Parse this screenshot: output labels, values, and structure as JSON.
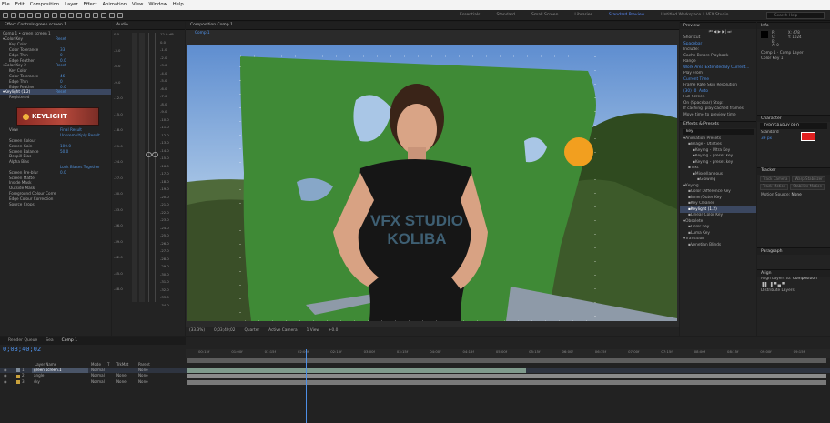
{
  "menubar": [
    "File",
    "Edit",
    "Composition",
    "Layer",
    "Effect",
    "Animation",
    "View",
    "Window",
    "Help"
  ],
  "workspaces": {
    "items": [
      "Essentials",
      "Standard",
      "Small Screen",
      "Libraries",
      "Standard Preview",
      "Untitled Workspace 1 VFX Studio"
    ],
    "active_index": 4
  },
  "search_help": {
    "placeholder": "Search Help"
  },
  "effect_controls": {
    "tab_label": "Effect Controls green screen.1",
    "breadcrumb": "Comp 1 • green screen 1",
    "rows": [
      {
        "label": "Color Key",
        "value": "Reset",
        "indent": 0,
        "sel": false
      },
      {
        "label": "Key Color",
        "value": "",
        "indent": 1,
        "sel": false
      },
      {
        "label": "Color Tolerance",
        "value": "33",
        "indent": 1,
        "sel": false
      },
      {
        "label": "Edge Thin",
        "value": "0",
        "indent": 1,
        "sel": false
      },
      {
        "label": "Edge Feather",
        "value": "0.0",
        "indent": 1,
        "sel": false
      },
      {
        "label": "Color Key 2",
        "value": "Reset",
        "indent": 0,
        "sel": false
      },
      {
        "label": "Key Color",
        "value": "",
        "indent": 1,
        "sel": false
      },
      {
        "label": "Color Tolerance",
        "value": "46",
        "indent": 1,
        "sel": false
      },
      {
        "label": "Edge Thin",
        "value": "0",
        "indent": 1,
        "sel": false
      },
      {
        "label": "Edge Feather",
        "value": "0.0",
        "indent": 1,
        "sel": false
      },
      {
        "label": "Keylight (1.2)",
        "value": "Reset",
        "indent": 0,
        "sel": true
      },
      {
        "label": "Registered",
        "value": "",
        "indent": 1,
        "sel": false
      }
    ],
    "logo_text": "KEYLIGHT",
    "rows2": [
      {
        "label": "View",
        "value": "Final Result",
        "indent": 1,
        "sel": false
      },
      {
        "label": "",
        "value": "Unpremultiply Result",
        "indent": 1,
        "sel": false
      },
      {
        "label": "Screen Colour",
        "value": "",
        "indent": 1,
        "sel": false
      },
      {
        "label": "Screen Gain",
        "value": "100.0",
        "indent": 1,
        "sel": false
      },
      {
        "label": "Screen Balance",
        "value": "50.0",
        "indent": 1,
        "sel": false
      },
      {
        "label": "Despill Bias",
        "value": "",
        "indent": 1,
        "sel": false
      },
      {
        "label": "Alpha Bias",
        "value": "",
        "indent": 1,
        "sel": false
      },
      {
        "label": "",
        "value": "Lock Biases Together",
        "indent": 1,
        "sel": false
      },
      {
        "label": "Screen Pre-blur",
        "value": "0.0",
        "indent": 1,
        "sel": false
      },
      {
        "label": "Screen Matte",
        "value": "",
        "indent": 1,
        "sel": false
      },
      {
        "label": "Inside Mask",
        "value": "",
        "indent": 1,
        "sel": false
      },
      {
        "label": "Outside Mask",
        "value": "",
        "indent": 1,
        "sel": false
      },
      {
        "label": "Foreground Colour Correction",
        "value": "",
        "indent": 1,
        "sel": false
      },
      {
        "label": "Edge Colour Correction",
        "value": "",
        "indent": 1,
        "sel": false
      },
      {
        "label": "Source Crops",
        "value": "",
        "indent": 1,
        "sel": false
      }
    ]
  },
  "audio": {
    "tab_label": "Audio",
    "left_scale": [
      "0.0",
      "-3.0",
      "-6.0",
      "-9.0",
      "-12.0",
      "-15.0",
      "-18.0",
      "-21.0",
      "-24.0",
      "-27.0",
      "-30.0",
      "-33.0",
      "-36.0",
      "-39.0",
      "-42.0",
      "-45.0",
      "-48.0"
    ],
    "right_scale": [
      "12.0 dB",
      "0.0",
      "-1.0",
      "-2.0",
      "-3.0",
      "-4.0",
      "-5.0",
      "-6.0",
      "-7.0",
      "-8.0",
      "-9.0",
      "-10.0",
      "-11.0",
      "-12.0",
      "-13.0",
      "-14.0",
      "-15.0",
      "-16.0",
      "-17.0",
      "-18.0",
      "-19.0",
      "-20.0",
      "-21.0",
      "-22.0",
      "-23.0",
      "-24.0",
      "-25.0",
      "-26.0",
      "-27.0",
      "-28.0",
      "-29.0",
      "-30.0",
      "-31.0",
      "-32.0",
      "-33.0",
      "-34.0"
    ]
  },
  "composition": {
    "tab_label": "Composition Comp 1",
    "sub_tab": "Comp 1",
    "shirt_line1": "VFX STUDIO",
    "shirt_line2": "KOLIBA",
    "viewer_controls": [
      "(33.3%)",
      "0;03;40;02",
      "Quarter",
      "Active Camera",
      "1 View",
      "+0.0"
    ]
  },
  "preview": {
    "title": "Preview",
    "shortcut_label": "Shortcut",
    "shortcut_value": "Spacebar",
    "include_label": "Include:",
    "cache_label": "Cache Before Playback",
    "range_label": "Range",
    "range_value": "Work Area Extended By Current...",
    "play_from_label": "Play From",
    "play_from_value": "Current Time",
    "frame_rate_label": "Frame Rate",
    "skip_label": "Skip",
    "resolution_label": "Resolution",
    "frame_rate_value": "(30)",
    "skip_value": "0",
    "resolution_value": "Auto",
    "fullscreen": "Full Screen",
    "on_stop": "On (Spacebar) Stop:",
    "if_caching": "If caching, play cached frames",
    "move_time": "Move time to preview time"
  },
  "effects_presets": {
    "title": "Effects & Presets",
    "search_value": "key",
    "items": [
      {
        "label": "Animation Presets",
        "indent": 0
      },
      {
        "label": "Image - Utilities",
        "indent": 1
      },
      {
        "label": "Keying - Ultra Key",
        "indent": 2
      },
      {
        "label": "Keying - preset.key",
        "indent": 2
      },
      {
        "label": "Keying - preset.key",
        "indent": 2
      },
      {
        "label": "Text",
        "indent": 1
      },
      {
        "label": "Miscellaneous",
        "indent": 2
      },
      {
        "label": "Glowing",
        "indent": 3
      },
      {
        "label": "Keying",
        "indent": 0
      },
      {
        "label": "Color Difference Key",
        "indent": 1
      },
      {
        "label": "Inner/Outer Key",
        "indent": 1
      },
      {
        "label": "Key Cleaner",
        "indent": 1
      },
      {
        "label": "Keylight (1.2)",
        "indent": 1
      },
      {
        "label": "Linear Color Key",
        "indent": 1
      },
      {
        "label": "Obsolete",
        "indent": 0
      },
      {
        "label": "Color Key",
        "indent": 1
      },
      {
        "label": "Luma Key",
        "indent": 1
      },
      {
        "label": "Transition",
        "indent": 0
      },
      {
        "label": "Venetian Blinds",
        "indent": 1
      }
    ]
  },
  "info": {
    "title": "Info",
    "r": "R:",
    "g": "G:",
    "b": "B:",
    "a": "A: 0",
    "x": "X: 478",
    "y": "Y: 1024",
    "line1": "Comp 1 · Comp Layer",
    "line2": "Color Key 1"
  },
  "character": {
    "title": "Character",
    "font": "TYPOGRAPHY PRO",
    "style": "Standard",
    "size": "39 px"
  },
  "tracker": {
    "title": "Tracker",
    "buttons": [
      "Track Camera",
      "Warp Stabilizer",
      "Track Motion",
      "Stabilize Motion"
    ],
    "motion_source_label": "Motion Source:",
    "motion_source_value": "None"
  },
  "paragraph": {
    "title": "Paragraph"
  },
  "align": {
    "title": "Align",
    "align_to_label": "Align Layers to:",
    "align_to_value": "Composition",
    "distribute_label": "Distribute Layers:"
  },
  "timeline": {
    "tabs": [
      "Render Queue",
      "Sea",
      "Comp 1"
    ],
    "timecode": "0;03;40;02",
    "ruler_ticks": [
      "00:15f",
      "01:00f",
      "01:15f",
      "02:00f",
      "02:15f",
      "03:00f",
      "03:15f",
      "04:00f",
      "04:15f",
      "05:00f",
      "05:15f",
      "06:00f",
      "06:15f",
      "07:00f",
      "07:15f",
      "08:00f",
      "08:15f",
      "09:00f",
      "09:15f"
    ],
    "columns": [
      "Layer Name",
      "Mode",
      "T",
      "TrkMat",
      "Parent"
    ],
    "layers": [
      {
        "num": "1",
        "name": "green screen.1",
        "mode": "Normal",
        "trk": "",
        "parent": "None",
        "color": "#7f8c9a",
        "bar_color": "#7f9a8c",
        "start": 0.0,
        "end": 0.53,
        "selected": true
      },
      {
        "num": "2",
        "name": "angle",
        "mode": "Normal",
        "trk": "None",
        "parent": "None",
        "color": "#c9a13b",
        "bar_color": "#8a8a8a",
        "start": 0.0,
        "end": 1.0,
        "selected": false
      },
      {
        "num": "3",
        "name": "sky",
        "mode": "Normal",
        "trk": "None",
        "parent": "None",
        "color": "#c9a13b",
        "bar_color": "#7a7a7a",
        "start": 0.0,
        "end": 1.0,
        "selected": false
      }
    ],
    "playhead_position": 0.185
  }
}
